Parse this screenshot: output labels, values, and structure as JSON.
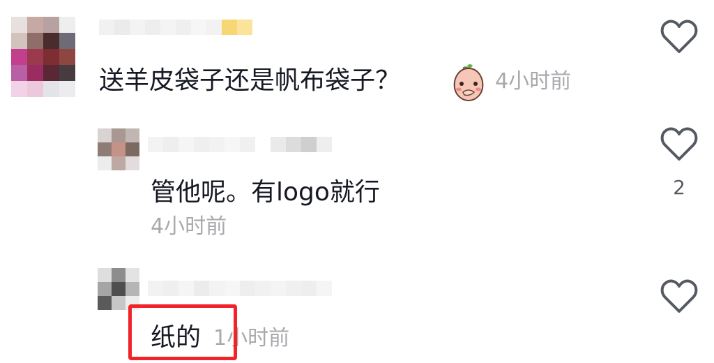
{
  "comments": [
    {
      "text": "送羊皮袋子还是帆布袋子？",
      "sticker": "shy-peach-sticker-icon",
      "time": "4小时前",
      "likes": ""
    },
    {
      "text": "管他呢。有logo就行",
      "time": "4小时前",
      "likes": "2"
    },
    {
      "text": "纸的",
      "time": "1小时前",
      "likes": ""
    }
  ],
  "icons": {
    "like": "heart-outline-icon"
  },
  "colors": {
    "time_text": "#a8a9ad",
    "highlight": "#f2242a",
    "heart_stroke": "#555962"
  }
}
